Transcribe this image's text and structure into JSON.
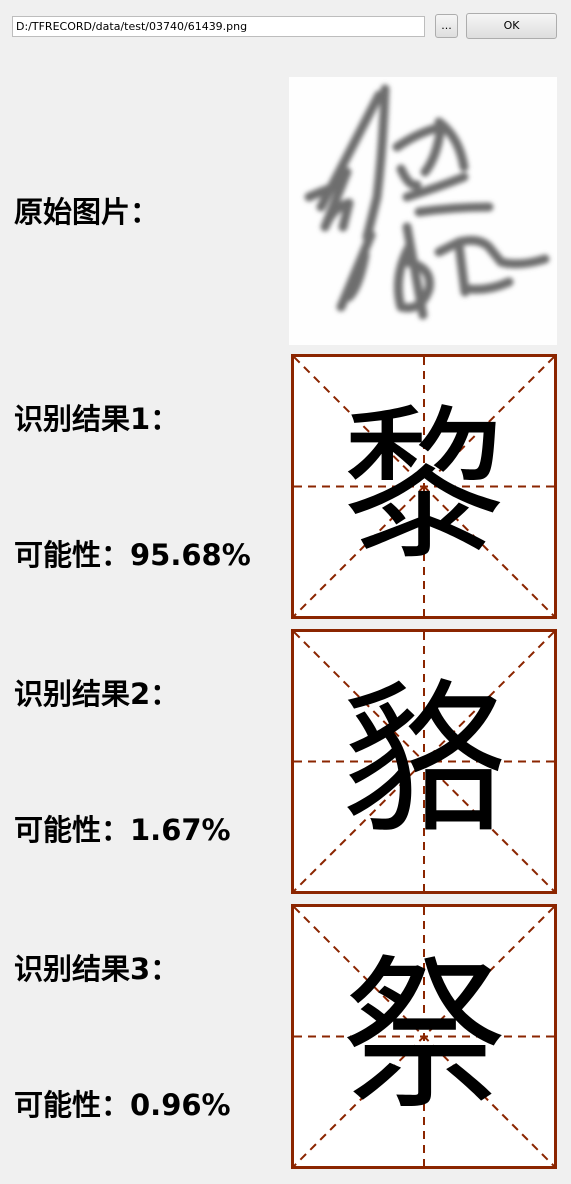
{
  "toolbar": {
    "path_value": "D:/TFRECORD/data/test/03740/61439.png",
    "browse_label": "...",
    "ok_label": "OK"
  },
  "original": {
    "label": "原始图片："
  },
  "results": [
    {
      "label": "识别结果1：",
      "char": "黎",
      "probability_label": "可能性：95.68%"
    },
    {
      "label": "识别结果2：",
      "char": "貉",
      "probability_label": "可能性：1.67%"
    },
    {
      "label": "识别结果3：",
      "char": "祭",
      "probability_label": "可能性：0.96%"
    }
  ],
  "colors": {
    "grid_border": "#8b2500",
    "grid_dash": "#8b2500",
    "background": "#f0f0f0"
  }
}
